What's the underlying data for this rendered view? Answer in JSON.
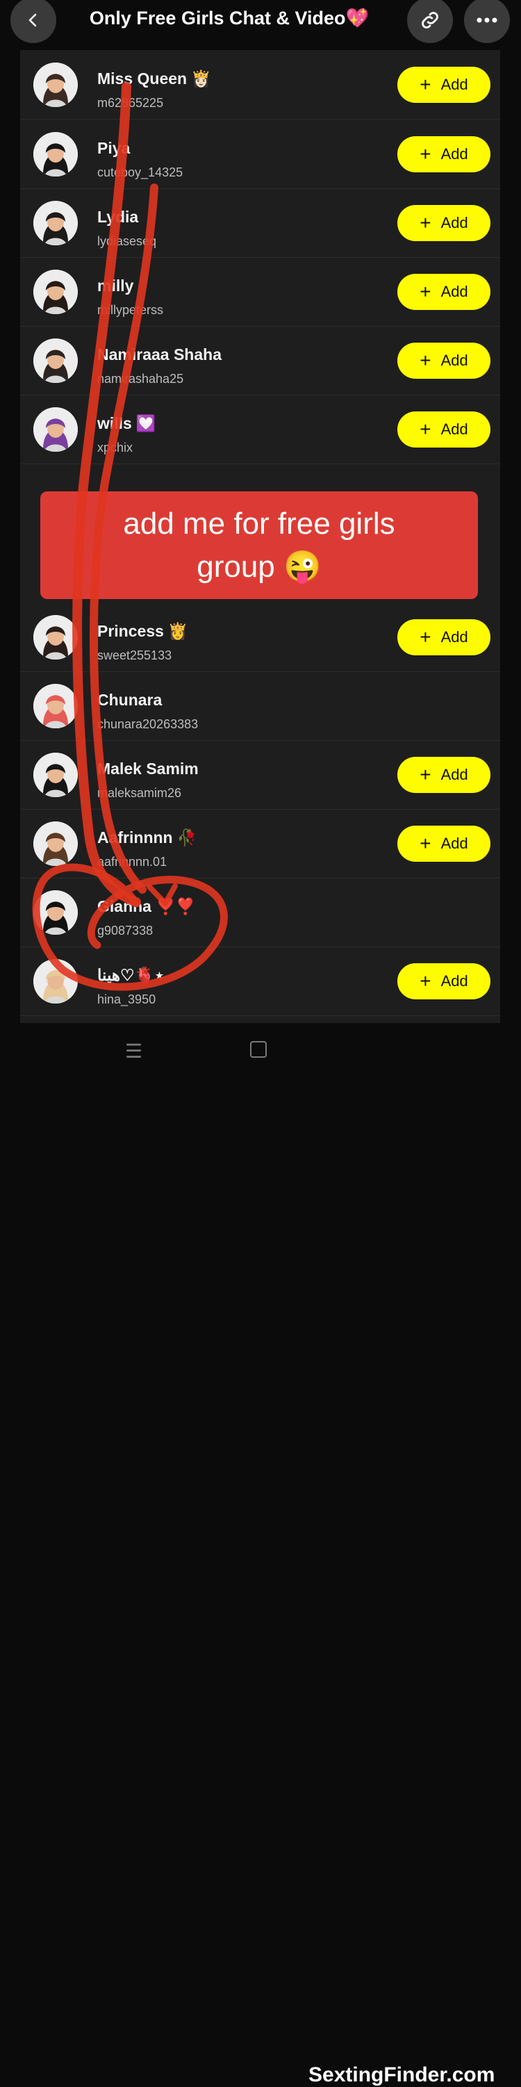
{
  "header": {
    "title": "Only Free Girls Chat & Video💖",
    "back_icon": "chevron-left-icon",
    "link_icon": "link-icon",
    "more_icon": "more-horizontal-icon"
  },
  "add_label": "Add",
  "contacts": [
    {
      "name": "Miss Queen",
      "emoji": "👸🏻",
      "username": "m62865225",
      "add": true,
      "hair": "#3b2a23"
    },
    {
      "name": "Piya",
      "emoji": "",
      "username": "cuteboy_14325",
      "add": true,
      "hair": "#151515"
    },
    {
      "name": "Lydia",
      "emoji": "",
      "username": "lydiaseseq",
      "add": true,
      "hair": "#1d1a1a"
    },
    {
      "name": "milly",
      "emoji": "",
      "username": "millypeterss",
      "add": true,
      "hair": "#241b16"
    },
    {
      "name": "Namiraaa Shaha",
      "emoji": "",
      "username": "namirashaha25",
      "add": true,
      "hair": "#2c2420"
    },
    {
      "name": "wills",
      "emoji": "💟",
      "username": "xpchix",
      "add": true,
      "hair": "#7b3fa0"
    },
    {
      "name": "Princess",
      "emoji": "👸",
      "username": "sweet255133",
      "add": true,
      "hair": "#2a1e1a"
    },
    {
      "name": "Chunara",
      "emoji": "",
      "username": "chunara20263383",
      "add": false,
      "hair": "#e45b57"
    },
    {
      "name": "Malek Samim",
      "emoji": "",
      "username": "maleksamim26",
      "add": true,
      "hair": "#151515"
    },
    {
      "name": "Aafrinnnn",
      "emoji": "🥀",
      "username": "aafrinnnn.01",
      "add": true,
      "hair": "#5a3b25"
    },
    {
      "name": "Gianna",
      "emoji": "❣️❣️",
      "username": "g9087338",
      "add": false,
      "hair": "#111111"
    },
    {
      "name": "هينا♡🫀⋆",
      "emoji": "",
      "username": "hina_3950",
      "add": true,
      "hair": "#e8c99a"
    }
  ],
  "overlay": {
    "line1": "add me for free girls",
    "line2": "group 😜"
  },
  "bottom_nav": {
    "menu_icon": "menu-lines-icon",
    "home_icon": "square-home-icon",
    "back_icon": "triangle-back-icon"
  },
  "watermark": "SextingFinder.com",
  "colors": {
    "accent_yellow": "#fffc00",
    "overlay_red": "#dc3b35",
    "scribble_red": "#e0351f",
    "list_bg": "#1e1e1e"
  }
}
